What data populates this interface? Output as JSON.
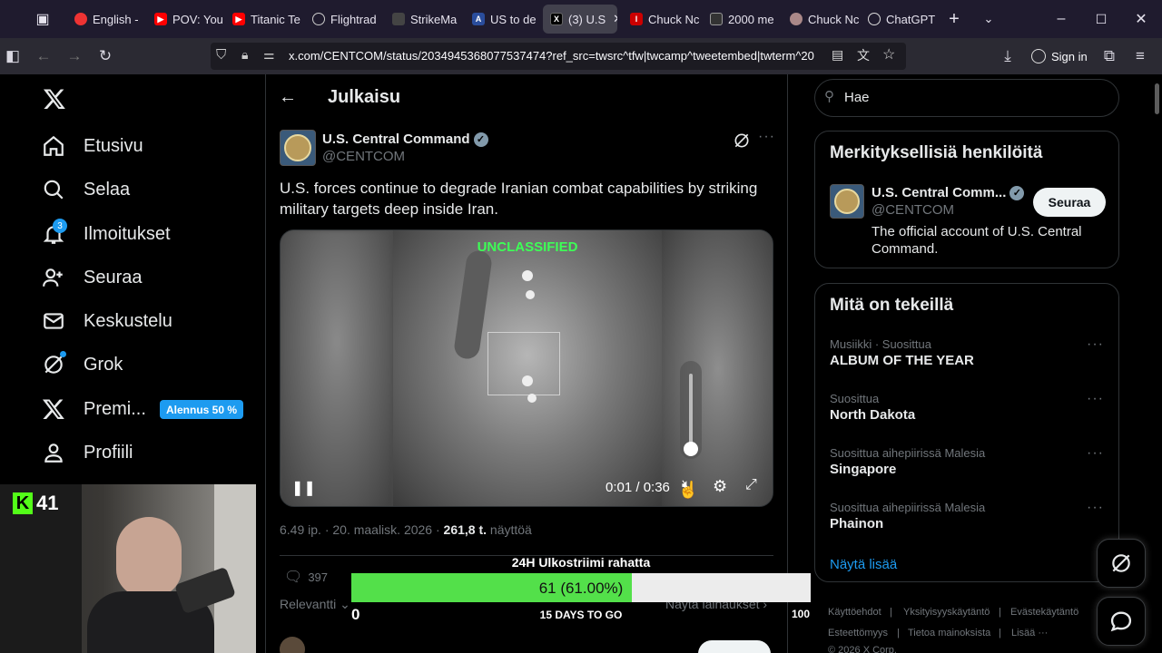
{
  "browser": {
    "tabs": [
      {
        "label": "English -",
        "color": "#e33"
      },
      {
        "label": "POV: You",
        "color": "#f00"
      },
      {
        "label": "Titanic Te",
        "color": "#f00"
      },
      {
        "label": "Flightrad",
        "color": "#888"
      },
      {
        "label": "StrikeMa",
        "color": "#444"
      },
      {
        "label": "US to de",
        "color": "#2a4d9c"
      },
      {
        "label": "(3) U.S",
        "color": "#000"
      },
      {
        "label": "Chuck Nc",
        "color": "#c00"
      },
      {
        "label": "2000 me",
        "color": "#333"
      },
      {
        "label": "Chuck Nc",
        "color": "#a88"
      },
      {
        "label": "ChatGPT",
        "color": "#555"
      }
    ],
    "url": "x.com/CENTCOM/status/2034945368077537474?ref_src=twsrc^tfw|twcamp^tweetembed|twterm^20",
    "sign_in": "Sign in"
  },
  "sidebar": {
    "items": [
      {
        "label": "Etusivu",
        "icon": "home-icon"
      },
      {
        "label": "Selaa",
        "icon": "search-icon"
      },
      {
        "label": "Ilmoitukset",
        "icon": "bell-icon"
      },
      {
        "label": "Seuraa",
        "icon": "follow-icon"
      },
      {
        "label": "Keskustelu",
        "icon": "mail-icon"
      },
      {
        "label": "Grok",
        "icon": "grok-icon"
      },
      {
        "label": "Premi...",
        "icon": "x-icon"
      },
      {
        "label": "Profiili",
        "icon": "profile-icon"
      }
    ],
    "notification_count": "3",
    "premium_badge": "Alennus 50 %"
  },
  "webcam": {
    "kick_count": "41"
  },
  "post": {
    "header": "Julkaisu",
    "author_name": "U.S. Central Command",
    "author_handle": "@CENTCOM",
    "text": "U.S. forces continue to degrade Iranian combat capabilities by striking military targets deep inside Iran.",
    "video_label": "UNCLASSIFIED",
    "video_time": "0:01 / 0:36",
    "meta_date": "6.49 ip. · 20. maalisk. 2026 ·",
    "meta_views": "261,8 t.",
    "meta_views_label": "näyttöä",
    "reply_count": "397",
    "sort_label": "Relevantti",
    "show_reposts": "Näytä lainaukset"
  },
  "overlay": {
    "title": "24H Ulkostriimi rahatta",
    "progress_text": "61 (61.00%)",
    "progress_fraction": 0.61,
    "min": "0",
    "max": "100",
    "subtitle": "15 DAYS TO GO"
  },
  "right": {
    "search_placeholder": "Hae",
    "people_title": "Merkityksellisiä henkilöitä",
    "person_name": "U.S. Central Comm...",
    "person_handle": "@CENTCOM",
    "person_bio": "The official account of U.S. Central Command.",
    "follow_label": "Seuraa",
    "trends_title": "Mitä on tekeillä",
    "trends": [
      {
        "sub": "Musiikki · Suosittua",
        "title": "ALBUM OF THE YEAR"
      },
      {
        "sub": "Suosittua",
        "title": "North Dakota"
      },
      {
        "sub": "Suosittua aihepiirissä Malesia",
        "title": "Singapore"
      },
      {
        "sub": "Suosittua aihepiirissä Malesia",
        "title": "Phainon"
      }
    ],
    "show_more": "Näytä lisää",
    "footer": [
      "Käyttöehdot",
      "Yksityisyyskäytäntö",
      "Evästekäytäntö",
      "Esteettömyys",
      "Tietoa mainoksista",
      "Lisää ···",
      "© 2026 X Corp."
    ]
  }
}
